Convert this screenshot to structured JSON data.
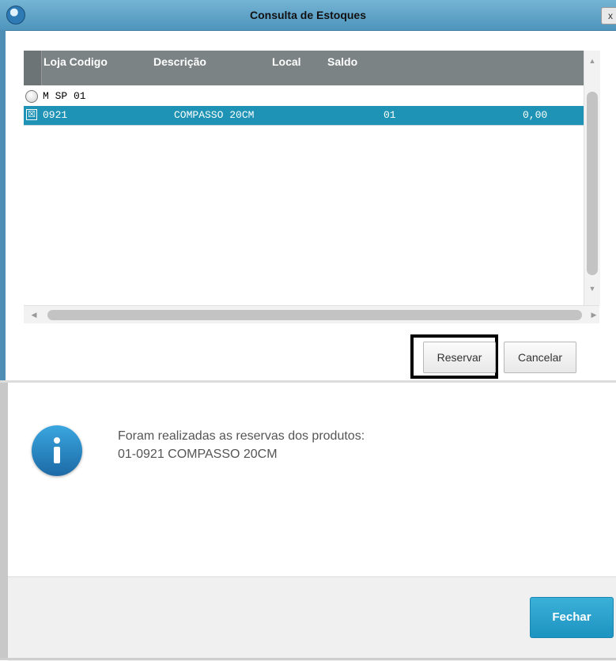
{
  "window": {
    "title": "Consulta de Estoques",
    "close_label": "x"
  },
  "grid": {
    "columns": [
      "Loja Codigo",
      "Descrição",
      "Local",
      "Saldo"
    ],
    "group_row": {
      "label": "M SP 01"
    },
    "selected_row": {
      "checkbox": "☒",
      "codigo": "0921",
      "descricao": "COMPASSO 20CM",
      "local": "01",
      "saldo": "0,00"
    }
  },
  "buttons": {
    "reservar": "Reservar",
    "cancelar": "Cancelar"
  },
  "message": {
    "line1": "Foram realizadas as reservas dos produtos:",
    "line2": "01-0921 COMPASSO 20CM",
    "ok_label": "Fechar"
  },
  "colors": {
    "titlebar": "#5fa3c9",
    "header": "#7b8384",
    "selected_row": "#1e93b5",
    "primary_button": "#1e95c3"
  },
  "icons": {
    "app": "app-logo-icon",
    "info": "info-icon",
    "scroll_up": "▲",
    "scroll_down": "▼",
    "scroll_left": "◀",
    "scroll_right": "▶"
  }
}
